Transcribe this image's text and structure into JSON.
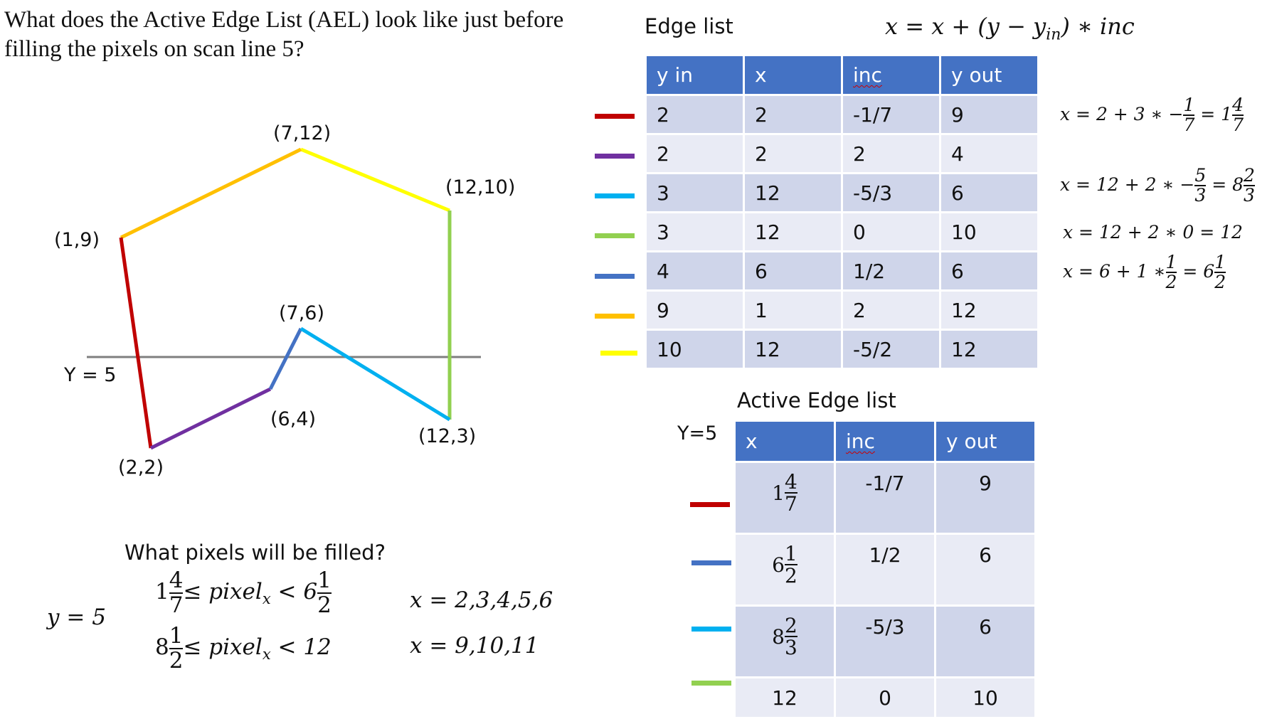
{
  "question": "What does the Active Edge List (AEL) look like just before filling the pixels on scan line 5?",
  "edge_list_title": "Edge list",
  "formula": "x = x + (y − y",
  "formula_sub": "in",
  "formula_tail": ") ∗ inc",
  "points": [
    "(7,12)",
    "(12,10)",
    "(1,9)",
    "(7,6)",
    "(6,4)",
    "(12,3)",
    "(2,2)"
  ],
  "scanline_label": "Y = 5",
  "edge_table": {
    "headers": [
      "y in",
      "x",
      "inc",
      "y out"
    ],
    "rows": [
      [
        "2",
        "2",
        "-1/7",
        "9"
      ],
      [
        "2",
        "2",
        "2",
        "4"
      ],
      [
        "3",
        "12",
        "-5/3",
        "6"
      ],
      [
        "3",
        "12",
        "0",
        "10"
      ],
      [
        "4",
        "6",
        "1/2",
        "6"
      ],
      [
        "9",
        "1",
        "2",
        "12"
      ],
      [
        "10",
        "12",
        "-5/2",
        "12"
      ]
    ],
    "colors": [
      "#C00000",
      "#7030A0",
      "#00B0F0",
      "#92D050",
      "#4472C4",
      "#FFC000",
      "#FFFF00"
    ]
  },
  "calcs": [
    {
      "lhs": "x = 2 + 3 ∗ −",
      "fn": "1",
      "fd": "7",
      "eq": " = 1",
      "rn": "4",
      "rd": "7"
    },
    {
      "lhs": "x = 12 + 2 ∗ −",
      "fn": "5",
      "fd": "3",
      "eq": " = 8",
      "rn": "2",
      "rd": "3"
    },
    {
      "lhs": "x = 12 + 2 ∗ 0 = 12"
    },
    {
      "lhs": "x = 6 + 1 ∗",
      "fn": "1",
      "fd": "2",
      "eq": " = 6",
      "rn": "1",
      "rd": "2"
    }
  ],
  "ael_title": "Active Edge list",
  "ael_y_label": "Y=5",
  "ael_table": {
    "headers": [
      "x",
      "inc",
      "y out"
    ],
    "rows": [
      {
        "x_whole": "1",
        "x_num": "4",
        "x_den": "7",
        "inc": "-1/7",
        "yout": "9"
      },
      {
        "x_whole": "6",
        "x_num": "1",
        "x_den": "2",
        "inc": "1/2",
        "yout": "6"
      },
      {
        "x_whole": "8",
        "x_num": "2",
        "x_den": "3",
        "inc": "-5/3",
        "yout": "6"
      },
      {
        "x_whole": "12",
        "inc": "0",
        "yout": "10"
      }
    ],
    "colors": [
      "#C00000",
      "#4472C4",
      "#00B0F0",
      "#92D050"
    ]
  },
  "fill_question": "What pixels will be filled?",
  "y_eq": "y = 5",
  "range1": {
    "w1": "1",
    "n1": "4",
    "d1": "7",
    "mid": "≤ pixel",
    "sub": "x",
    "lt": " < 6",
    "n2": "1",
    "d2": "2"
  },
  "range2": {
    "w1": "8",
    "n1": "1",
    "d1": "2",
    "mid": "≤ pixel",
    "sub": "x",
    "lt": " < 12"
  },
  "result1": "x = 2,3,4,5,6",
  "result2": "x = 9,10,11"
}
